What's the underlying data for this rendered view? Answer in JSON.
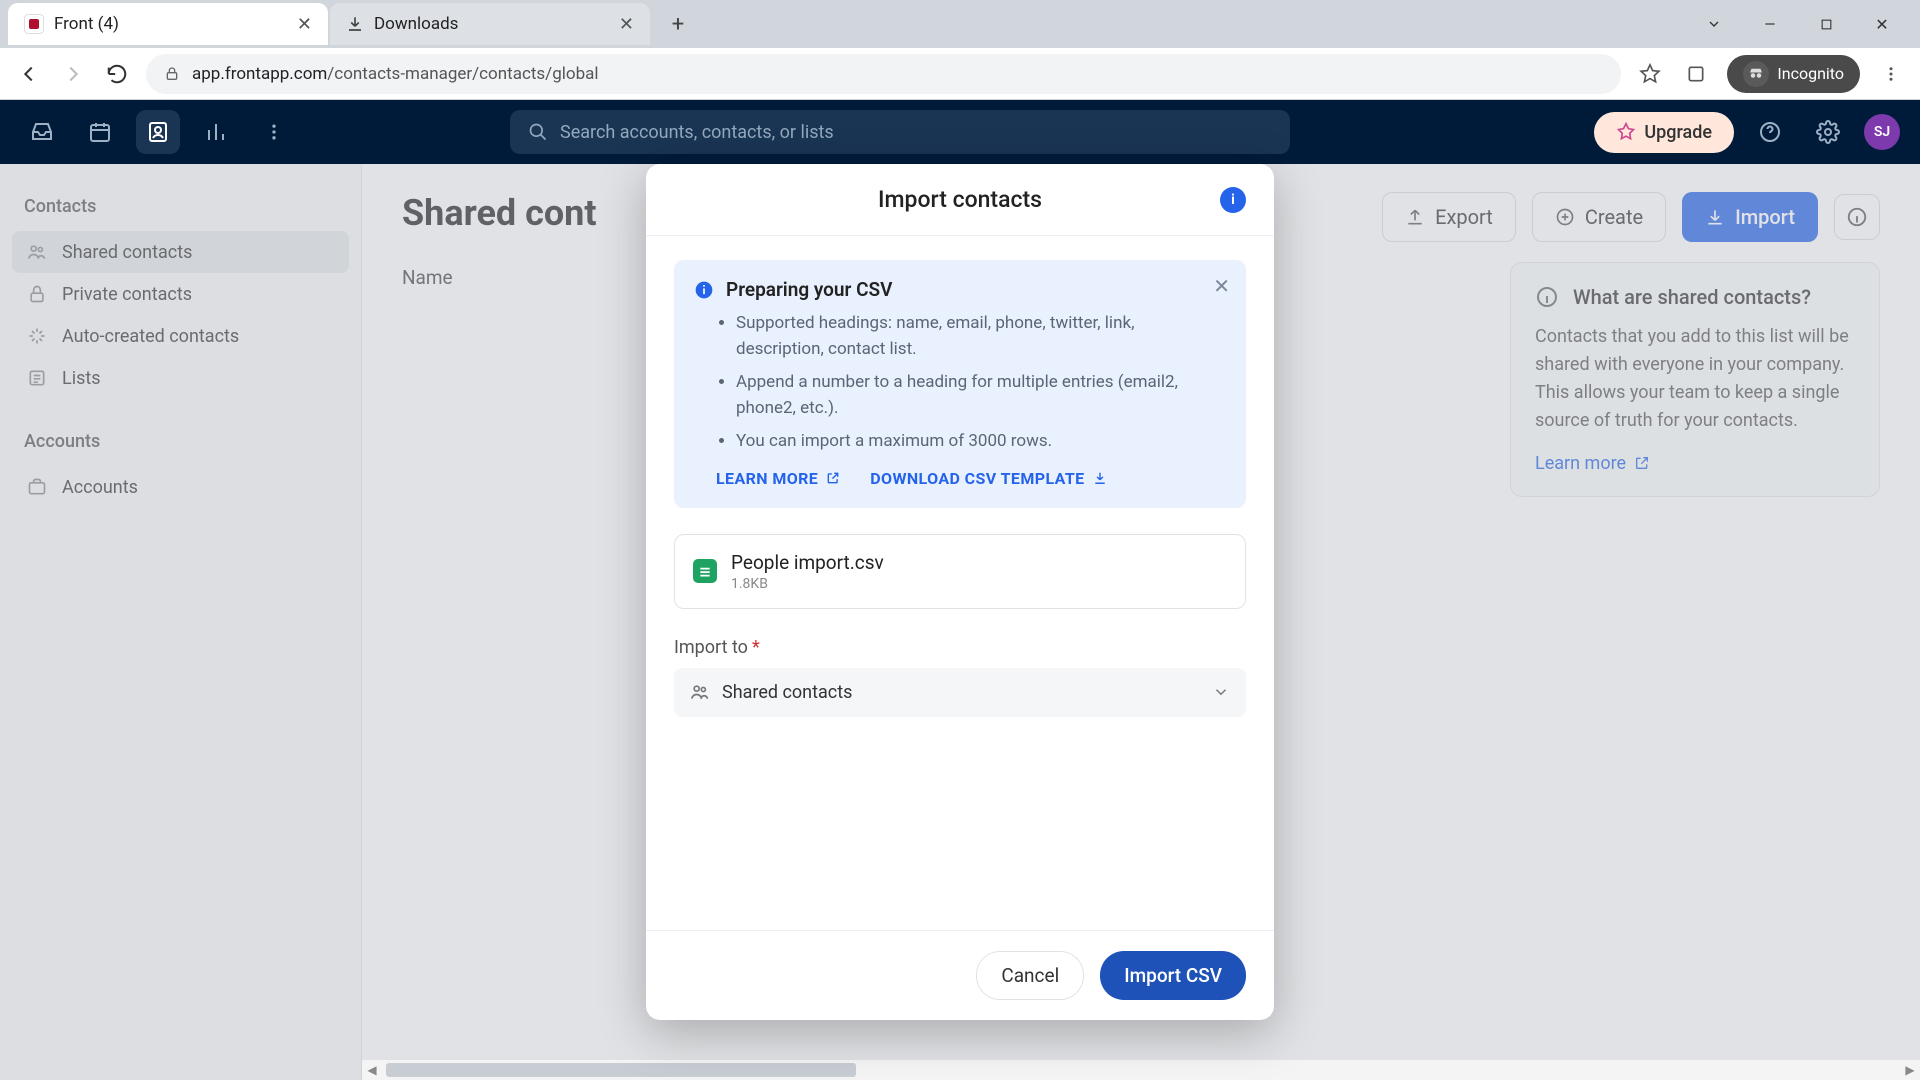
{
  "browser": {
    "tabs": [
      {
        "title": "Front (4)",
        "active": true
      },
      {
        "title": "Downloads",
        "active": false
      }
    ],
    "url_domain": "app.frontapp.com",
    "url_path": "/contacts-manager/contacts/global",
    "incognito_label": "Incognito"
  },
  "header": {
    "search_placeholder": "Search accounts, contacts, or lists",
    "upgrade_label": "Upgrade",
    "avatar_initials": "SJ"
  },
  "sidebar": {
    "section_contacts": "Contacts",
    "items_contacts": [
      "Shared contacts",
      "Private contacts",
      "Auto-created contacts",
      "Lists"
    ],
    "section_accounts": "Accounts",
    "items_accounts": [
      "Accounts"
    ]
  },
  "main": {
    "title": "Shared cont",
    "col_name": "Name",
    "export_label": "Export",
    "create_label": "Create",
    "import_label": "Import"
  },
  "info_panel": {
    "heading": "What are shared contacts?",
    "body": "Contacts that you add to this list will be shared with everyone in your company. This allows your team to keep a single source of truth for your contacts.",
    "link": "Learn more"
  },
  "modal": {
    "title": "Import contacts",
    "csv_heading": "Preparing your CSV",
    "csv_bullets": [
      "Supported headings: name, email, phone, twitter, link, description, contact list.",
      "Append a number to a heading for multiple entries (email2, phone2, etc.).",
      "You can import a maximum of 3000 rows."
    ],
    "learn_more": "LEARN MORE",
    "download_template": "DOWNLOAD CSV TEMPLATE",
    "file_name": "People import.csv",
    "file_size": "1.8KB",
    "import_to_label": "Import to",
    "import_to_value": "Shared contacts",
    "cancel_label": "Cancel",
    "submit_label": "Import CSV"
  }
}
